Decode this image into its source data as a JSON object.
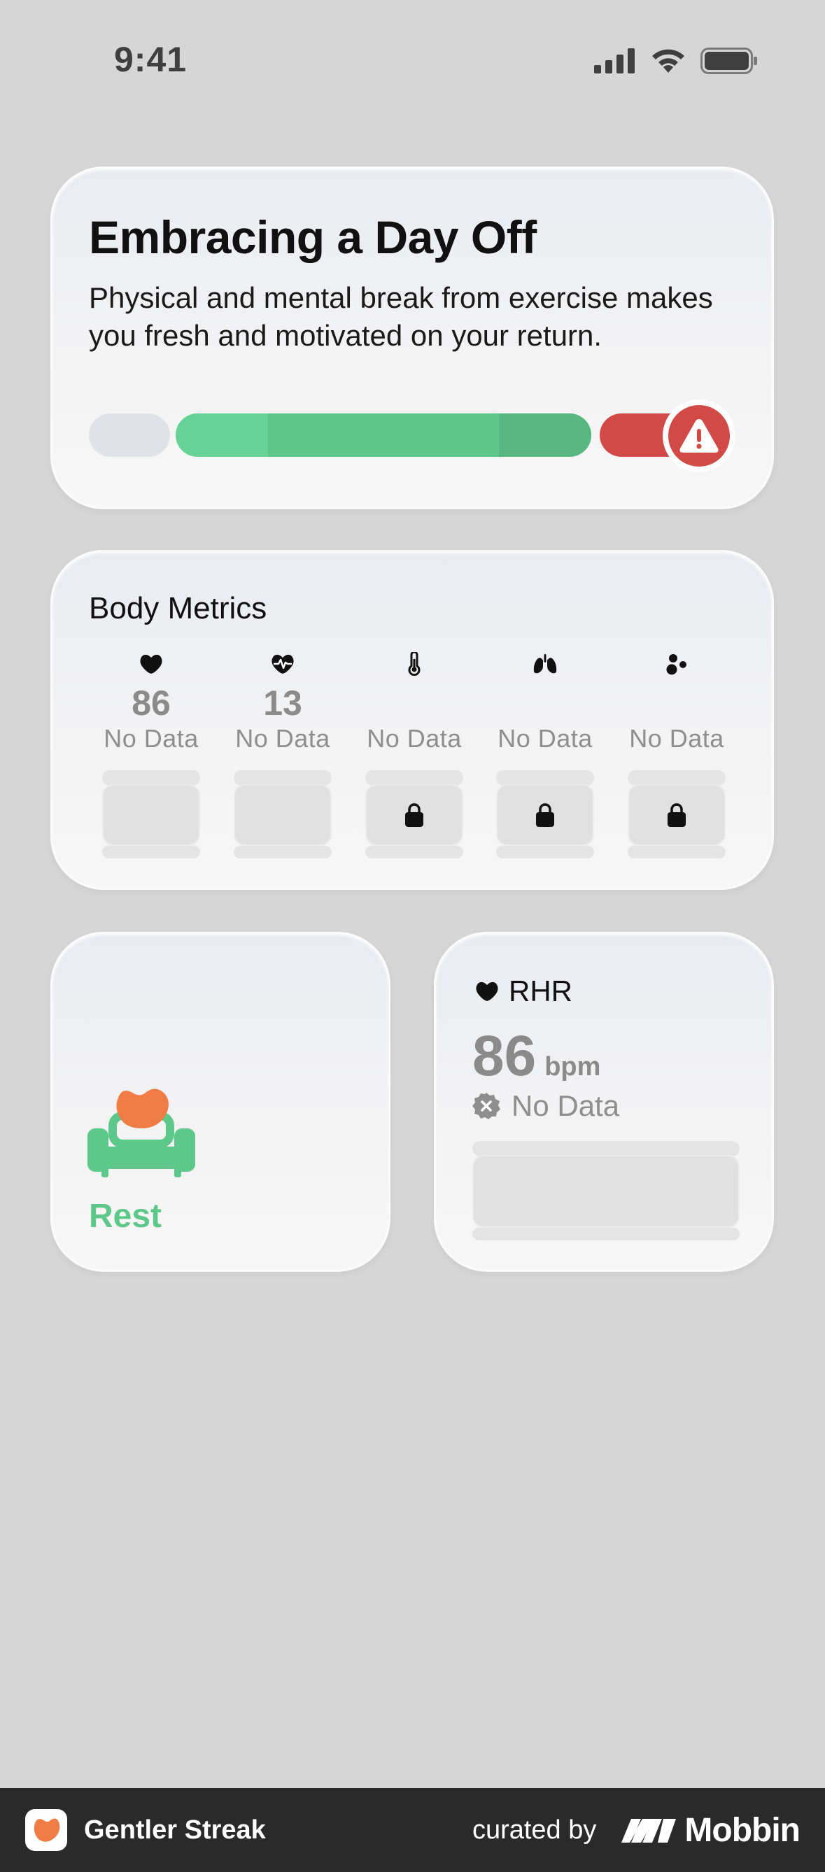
{
  "status_bar": {
    "time": "9:41",
    "icons": [
      "cellular-signal-icon",
      "wifi-icon",
      "battery-icon"
    ]
  },
  "day_off_widget": {
    "title": "Embracing a Day Off",
    "description": "Physical and mental break from exercise makes you fresh and motivated on your return.",
    "warning_icon": "warning-icon",
    "colors": {
      "green": "#66d295",
      "red": "#d14a46",
      "gray": "#dfe2e6"
    }
  },
  "body_metrics_widget": {
    "title": "Body Metrics",
    "metrics": [
      {
        "icon": "heart-icon",
        "value": "86",
        "status": "No Data",
        "locked": false
      },
      {
        "icon": "hrv-icon",
        "value": "13",
        "status": "No Data",
        "locked": false
      },
      {
        "icon": "thermometer-icon",
        "value": "",
        "status": "No Data",
        "locked": true
      },
      {
        "icon": "lungs-icon",
        "value": "",
        "status": "No Data",
        "locked": true
      },
      {
        "icon": "oxygen-icon",
        "value": "",
        "status": "No Data",
        "locked": true
      }
    ]
  },
  "rest_widget": {
    "label": "Rest",
    "icon": "rest-couch-icon",
    "accent": "#5ec88a"
  },
  "rhr_widget": {
    "title": "RHR",
    "value": "86",
    "unit": "bpm",
    "status": "No Data",
    "status_icon": "no-data-badge-icon"
  },
  "banner": {
    "app_name": "Gentler Streak",
    "curated_by": "curated by",
    "brand": "Mobbin"
  }
}
